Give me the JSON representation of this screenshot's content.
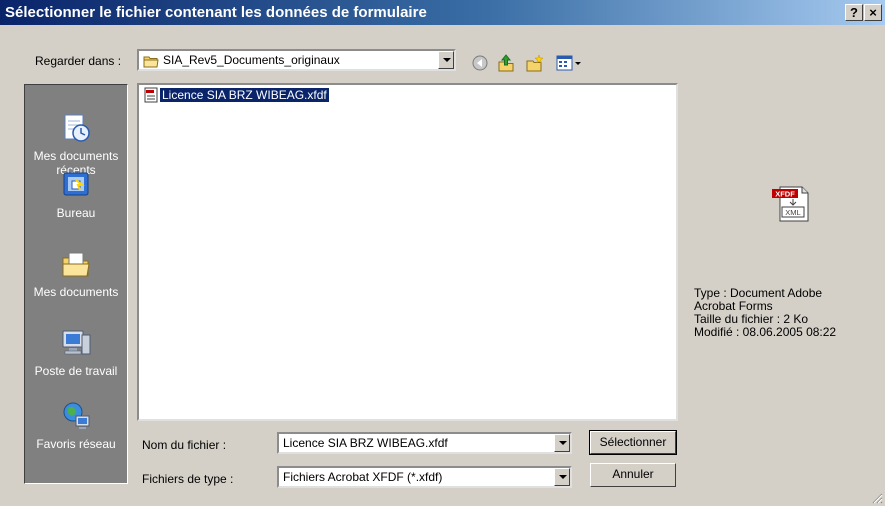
{
  "window": {
    "title": "Sélectionner le fichier contenant les données de formulaire",
    "help_label": "?",
    "close_label": "×"
  },
  "lookin": {
    "label": "Regarder dans :",
    "value": "SIA_Rev5_Documents_originaux"
  },
  "places": [
    {
      "label": "Mes documents récents",
      "icon": "recent-documents-icon"
    },
    {
      "label": "Bureau",
      "icon": "desktop-icon"
    },
    {
      "label": "Mes documents",
      "icon": "my-documents-icon"
    },
    {
      "label": "Poste de travail",
      "icon": "my-computer-icon"
    },
    {
      "label": "Favoris réseau",
      "icon": "network-places-icon"
    }
  ],
  "files": [
    {
      "name": "Licence SIA BRZ WIBEAG.xfdf",
      "selected": true
    }
  ],
  "preview": {
    "icon_text_top": "XFDF",
    "icon_text_bottom": "XML",
    "type_line1": "Type : Document Adobe",
    "type_line2": "Acrobat Forms",
    "size": "Taille du fichier : 2 Ko",
    "modified": "Modifié : 08.06.2005 08:22"
  },
  "filename": {
    "label": "Nom du fichier :",
    "value": "Licence SIA BRZ WIBEAG.xfdf"
  },
  "filetype": {
    "label": "Fichiers de type :",
    "value": "Fichiers Acrobat XFDF (*.xfdf)"
  },
  "buttons": {
    "select": "Sélectionner",
    "cancel": "Annuler"
  },
  "colors": {
    "titlebar_start": "#0a246a",
    "titlebar_end": "#a6caf0",
    "face": "#d4d0c8",
    "places_bg": "#808080",
    "selection": "#0a246a"
  }
}
